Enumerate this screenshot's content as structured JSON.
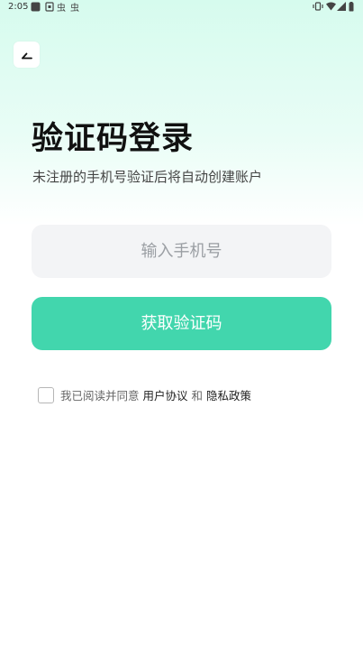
{
  "status_bar": {
    "time": "2:05",
    "left_icons": [
      "notification-square-icon",
      "app-icon",
      "bug-icon",
      "bug-icon"
    ],
    "right_icons": [
      "vibrate-icon",
      "wifi-icon",
      "signal-icon",
      "battery-icon"
    ]
  },
  "header": {
    "back_icon": "back-arrow-icon"
  },
  "main": {
    "title": "验证码登录",
    "subtitle": "未注册的手机号验证后将自动创建账户"
  },
  "form": {
    "phone_placeholder": "输入手机号",
    "phone_value": "",
    "submit_label": "获取验证码"
  },
  "agreement": {
    "checked": false,
    "prefix": "我已阅读并同意",
    "user_agreement": "用户协议",
    "and": "和",
    "privacy_policy": "隐私政策"
  },
  "colors": {
    "accent": "#42d6ad",
    "gradient_top": "#d6fbee",
    "input_bg": "#f3f4f6"
  }
}
